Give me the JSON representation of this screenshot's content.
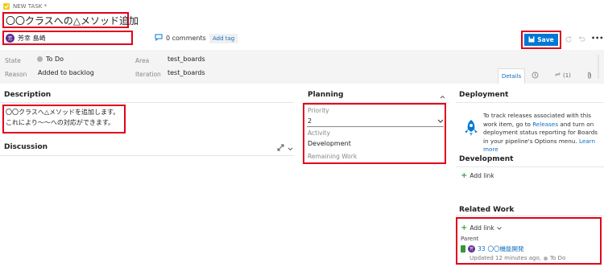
{
  "header": {
    "type_label": "NEW TASK *",
    "title": "〇〇クラスへの△メソッド追加",
    "assignee_initial": "芳",
    "assignee_name": "芳幸 島崎",
    "comments_label": "0 comments",
    "add_tag_label": "Add tag",
    "save_label": "Save",
    "more_label": "•••"
  },
  "fields": {
    "state_label": "State",
    "state_value": "To Do",
    "reason_label": "Reason",
    "reason_value": "Added to backlog",
    "area_label": "Area",
    "area_value": "test_boards",
    "iteration_label": "Iteration",
    "iteration_value": "test_boards"
  },
  "tabs": {
    "details": "Details",
    "links_count": "(1)"
  },
  "description": {
    "heading": "Description",
    "line1": "〇〇クラスへ△メソッドを追加します。",
    "line2": "これにより～～への対応ができます。"
  },
  "discussion": {
    "heading": "Discussion"
  },
  "planning": {
    "heading": "Planning",
    "priority_label": "Priority",
    "priority_value": "2",
    "activity_label": "Activity",
    "activity_value": "Development",
    "remaining_label": "Remaining Work"
  },
  "deployment": {
    "heading": "Deployment",
    "text_1": "To track releases associated with this work item, go to ",
    "releases_link": "Releases",
    "text_2": " and turn on deployment status reporting for Boards in your pipeline's Options menu. ",
    "learn_more": "Learn more"
  },
  "development": {
    "heading": "Development",
    "add_link": "Add link"
  },
  "related": {
    "heading": "Related Work",
    "add_link": "Add link",
    "parent_label": "Parent",
    "parent_id": "33",
    "parent_title": "〇〇機能開発",
    "parent_avatar": "芳",
    "parent_meta": "Updated 12 minutes ago,",
    "parent_state": "To Do"
  },
  "colors": {
    "accent": "#0078d4",
    "red_box": "#e0001b",
    "avatar": "#5c2d91",
    "feature_green": "#339933"
  }
}
